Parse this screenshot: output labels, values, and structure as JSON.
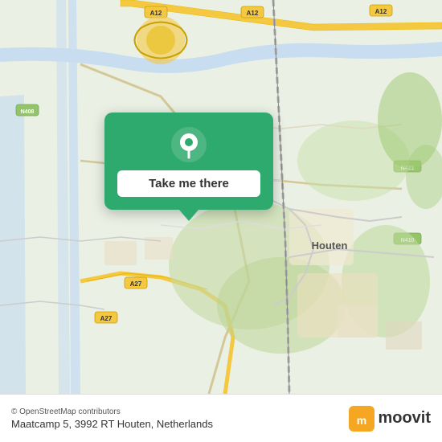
{
  "map": {
    "alt": "Map of Houten Netherlands"
  },
  "popup": {
    "button_label": "Take me there",
    "pin_alt": "Location pin"
  },
  "bottom_bar": {
    "attribution": "© OpenStreetMap contributors",
    "address": "Maatcamp 5, 3992 RT Houten, Netherlands",
    "logo_text": "moovit"
  }
}
